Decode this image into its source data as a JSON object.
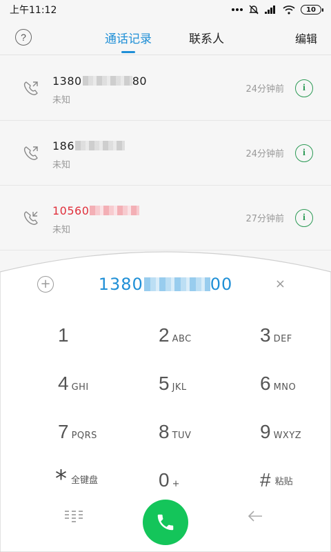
{
  "status_bar": {
    "time": "上午11:12",
    "battery": "10"
  },
  "header": {
    "help_icon": "?",
    "tabs": [
      "通话记录",
      "联系人"
    ],
    "edit_label": "编辑"
  },
  "calls": [
    {
      "number_prefix": "1380",
      "number_suffix": "80",
      "location": "未知",
      "time": "24分钟前",
      "type": "outgoing"
    },
    {
      "number_prefix": "186",
      "number_suffix": "",
      "location": "未知",
      "time": "24分钟前",
      "type": "outgoing"
    },
    {
      "number_prefix": "10560",
      "number_suffix": "",
      "location": "未知",
      "time": "27分钟前",
      "type": "missed"
    }
  ],
  "dialer": {
    "dialed_prefix": "1380",
    "dialed_suffix": "00",
    "clear_glyph": "×",
    "keys": [
      {
        "digit": "1",
        "letters": ""
      },
      {
        "digit": "2",
        "letters": "ABC"
      },
      {
        "digit": "3",
        "letters": "DEF"
      },
      {
        "digit": "4",
        "letters": "GHI"
      },
      {
        "digit": "5",
        "letters": "JKL"
      },
      {
        "digit": "6",
        "letters": "MNO"
      },
      {
        "digit": "7",
        "letters": "PQRS"
      },
      {
        "digit": "8",
        "letters": "TUV"
      },
      {
        "digit": "9",
        "letters": "WXYZ"
      },
      {
        "digit": "*",
        "letters": "全键盘"
      },
      {
        "digit": "0",
        "letters": "+"
      },
      {
        "digit": "#",
        "letters": "粘贴"
      }
    ]
  },
  "colors": {
    "accent": "#1f8fd6",
    "missed": "#e0303c",
    "info": "#2c9a55",
    "call_button": "#14c55a"
  },
  "icons": {
    "call_outgoing": "phone-outgoing-icon",
    "call_missed": "phone-incoming-icon",
    "info": "info-icon",
    "add_contact": "add-circle-icon",
    "clear": "close-icon",
    "dialpad": "dialpad-icon",
    "call": "phone-icon",
    "backspace": "arrow-left-icon"
  }
}
